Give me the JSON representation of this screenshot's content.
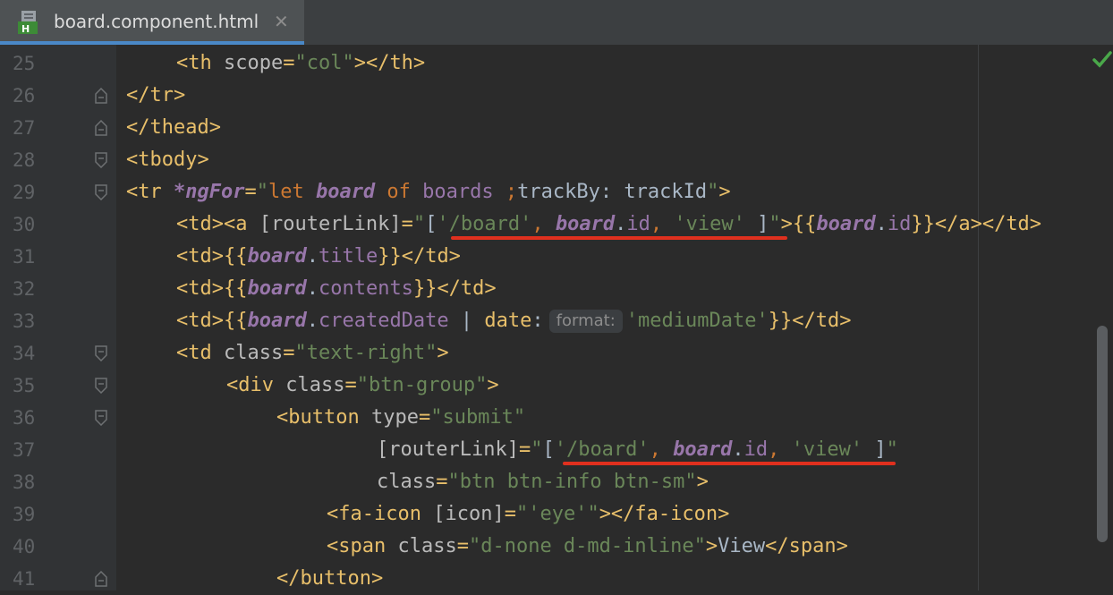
{
  "tab": {
    "filename": "board.component.html",
    "icon": "html-file-icon",
    "icon_letter": "H",
    "close_glyph": "✕"
  },
  "editor": {
    "status_icon": "check-icon",
    "lines": [
      {
        "n": "25",
        "fold": "none",
        "indent": 2,
        "tokens": [
          [
            "tag",
            "<th "
          ],
          [
            "attr",
            "scope"
          ],
          [
            "tag",
            "="
          ],
          [
            "str",
            "\"col\""
          ],
          [
            "tag",
            "></th>"
          ]
        ]
      },
      {
        "n": "26",
        "fold": "end",
        "indent": 0,
        "tokens": [
          [
            "tag",
            "</tr>"
          ]
        ]
      },
      {
        "n": "27",
        "fold": "end",
        "indent": 0,
        "tokens": [
          [
            "tag",
            "</thead>"
          ]
        ]
      },
      {
        "n": "28",
        "fold": "start",
        "indent": 0,
        "tokens": [
          [
            "tag",
            "<tbody>"
          ]
        ]
      },
      {
        "n": "29",
        "fold": "start",
        "indent": 0,
        "tokens": [
          [
            "tag",
            "<tr "
          ],
          [
            "var",
            "*ngFor"
          ],
          [
            "tag",
            "="
          ],
          [
            "str",
            "\""
          ],
          [
            "kw",
            "let "
          ],
          [
            "var",
            "board"
          ],
          [
            "kw",
            " of "
          ],
          [
            "prop",
            "boards"
          ],
          [
            "plain",
            " "
          ],
          [
            "kw",
            ";"
          ],
          [
            "plain",
            "trackBy: trackId"
          ],
          [
            "str",
            "\""
          ],
          [
            "tag",
            ">"
          ]
        ]
      },
      {
        "n": "30",
        "fold": "none",
        "indent": 2,
        "tokens": [
          [
            "tag",
            "<td><a "
          ],
          [
            "attr",
            "[routerLink]"
          ],
          [
            "tag",
            "="
          ],
          [
            "str",
            "\""
          ],
          [
            "plain",
            "["
          ],
          [
            "str",
            "'/board'"
          ],
          [
            "kw",
            ", "
          ],
          [
            "var",
            "board"
          ],
          [
            "plain",
            "."
          ],
          [
            "prop",
            "id"
          ],
          [
            "kw",
            ", "
          ],
          [
            "str",
            "'view'"
          ],
          [
            "plain",
            " ]"
          ],
          [
            "str",
            "\""
          ],
          [
            "tag",
            ">"
          ],
          [
            "br",
            "{{"
          ],
          [
            "var",
            "board"
          ],
          [
            "plain",
            "."
          ],
          [
            "prop",
            "id"
          ],
          [
            "br",
            "}}"
          ],
          [
            "tag",
            "</a></td>"
          ]
        ]
      },
      {
        "n": "31",
        "fold": "none",
        "indent": 2,
        "tokens": [
          [
            "tag",
            "<td>"
          ],
          [
            "br",
            "{{"
          ],
          [
            "var",
            "board"
          ],
          [
            "plain",
            "."
          ],
          [
            "prop",
            "title"
          ],
          [
            "br",
            "}}"
          ],
          [
            "tag",
            "</td>"
          ]
        ]
      },
      {
        "n": "32",
        "fold": "none",
        "indent": 2,
        "tokens": [
          [
            "tag",
            "<td>"
          ],
          [
            "br",
            "{{"
          ],
          [
            "var",
            "board"
          ],
          [
            "plain",
            "."
          ],
          [
            "prop",
            "contents"
          ],
          [
            "br",
            "}}"
          ],
          [
            "tag",
            "</td>"
          ]
        ]
      },
      {
        "n": "33",
        "fold": "none",
        "indent": 2,
        "tokens": [
          [
            "tag",
            "<td>"
          ],
          [
            "br",
            "{{"
          ],
          [
            "var",
            "board"
          ],
          [
            "plain",
            "."
          ],
          [
            "prop",
            "createdDate"
          ],
          [
            "plain",
            " | "
          ],
          [
            "tag",
            "date"
          ],
          [
            "plain",
            ":"
          ],
          [
            "hint",
            "format:"
          ],
          [
            "str",
            "'mediumDate'"
          ],
          [
            "br",
            "}}"
          ],
          [
            "tag",
            "</td>"
          ]
        ]
      },
      {
        "n": "34",
        "fold": "start",
        "indent": 2,
        "tokens": [
          [
            "tag",
            "<td "
          ],
          [
            "attr",
            "class"
          ],
          [
            "tag",
            "="
          ],
          [
            "str",
            "\"text-right\""
          ],
          [
            "tag",
            ">"
          ]
        ]
      },
      {
        "n": "35",
        "fold": "start",
        "indent": 4,
        "tokens": [
          [
            "tag",
            "<div "
          ],
          [
            "attr",
            "class"
          ],
          [
            "tag",
            "="
          ],
          [
            "str",
            "\"btn-group\""
          ],
          [
            "tag",
            ">"
          ]
        ]
      },
      {
        "n": "36",
        "fold": "start",
        "indent": 6,
        "tokens": [
          [
            "tag",
            "<button "
          ],
          [
            "attr",
            "type"
          ],
          [
            "tag",
            "="
          ],
          [
            "str",
            "\"submit\""
          ]
        ]
      },
      {
        "n": "37",
        "fold": "none",
        "indent": 10,
        "tokens": [
          [
            "attr",
            "[routerLink]"
          ],
          [
            "tag",
            "="
          ],
          [
            "str",
            "\""
          ],
          [
            "plain",
            "["
          ],
          [
            "str",
            "'/board'"
          ],
          [
            "kw",
            ", "
          ],
          [
            "var",
            "board"
          ],
          [
            "plain",
            "."
          ],
          [
            "prop",
            "id"
          ],
          [
            "kw",
            ", "
          ],
          [
            "str",
            "'view'"
          ],
          [
            "plain",
            " ]"
          ],
          [
            "str",
            "\""
          ]
        ]
      },
      {
        "n": "38",
        "fold": "none",
        "indent": 10,
        "tokens": [
          [
            "attr",
            "class"
          ],
          [
            "tag",
            "="
          ],
          [
            "str",
            "\"btn btn-info btn-sm\""
          ],
          [
            "tag",
            ">"
          ]
        ]
      },
      {
        "n": "39",
        "fold": "none",
        "indent": 8,
        "tokens": [
          [
            "tag",
            "<fa-icon "
          ],
          [
            "attr",
            "[icon]"
          ],
          [
            "tag",
            "="
          ],
          [
            "str",
            "\""
          ],
          [
            "str",
            "'eye'"
          ],
          [
            "str",
            "\""
          ],
          [
            "tag",
            "></fa-icon>"
          ]
        ]
      },
      {
        "n": "40",
        "fold": "none",
        "indent": 8,
        "tokens": [
          [
            "tag",
            "<span "
          ],
          [
            "attr",
            "class"
          ],
          [
            "tag",
            "="
          ],
          [
            "str",
            "\"d-none d-md-inline\""
          ],
          [
            "tag",
            ">"
          ],
          [
            "plain",
            "View"
          ],
          [
            "tag",
            "</span>"
          ]
        ]
      },
      {
        "n": "41",
        "fold": "end",
        "indent": 6,
        "tokens": [
          [
            "tag",
            "</button>"
          ]
        ]
      }
    ]
  }
}
